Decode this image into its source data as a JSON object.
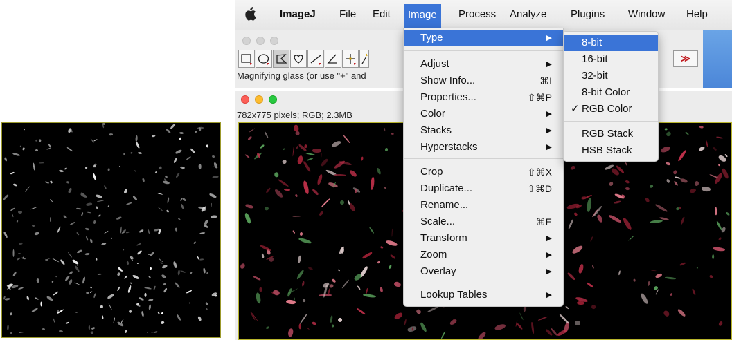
{
  "menubar": {
    "app": "ImageJ",
    "items": [
      "File",
      "Edit",
      "Image",
      "Process",
      "Analyze",
      "Plugins",
      "Window",
      "Help"
    ],
    "active": "Image"
  },
  "toolbar": {
    "status_hint": "Magnifying glass (or use \"+\" and",
    "more_label": "≫"
  },
  "image_window": {
    "info": "782x775 pixels; RGB; 2.3MB"
  },
  "image_menu": {
    "items": [
      {
        "label": "Type",
        "submenu": true,
        "highlighted": true
      },
      {
        "label": "Adjust",
        "submenu": true
      },
      {
        "label": "Show Info...",
        "shortcut": "⌘I"
      },
      {
        "label": "Properties...",
        "shortcut": "⇧⌘P"
      },
      {
        "label": "Color",
        "submenu": true
      },
      {
        "label": "Stacks",
        "submenu": true
      },
      {
        "label": "Hyperstacks",
        "submenu": true
      },
      {
        "label": "Crop",
        "shortcut": "⇧⌘X"
      },
      {
        "label": "Duplicate...",
        "shortcut": "⇧⌘D"
      },
      {
        "label": "Rename..."
      },
      {
        "label": "Scale...",
        "shortcut": "⌘E"
      },
      {
        "label": "Transform",
        "submenu": true
      },
      {
        "label": "Zoom",
        "submenu": true
      },
      {
        "label": "Overlay",
        "submenu": true
      },
      {
        "label": "Lookup Tables",
        "submenu": true
      }
    ],
    "arrow": "▶"
  },
  "type_menu": {
    "items": [
      {
        "label": "8-bit",
        "highlighted": true
      },
      {
        "label": "16-bit"
      },
      {
        "label": "32-bit"
      },
      {
        "label": "8-bit Color"
      },
      {
        "label": "RGB Color",
        "checked": true
      },
      {
        "label": "RGB Stack"
      },
      {
        "label": "HSB Stack"
      }
    ],
    "check_mark": "✓"
  },
  "colors": {
    "menu_highlight": "#3a74d7",
    "close": "#fc5f57",
    "minimize": "#fdbc2e",
    "zoom": "#28c840"
  }
}
